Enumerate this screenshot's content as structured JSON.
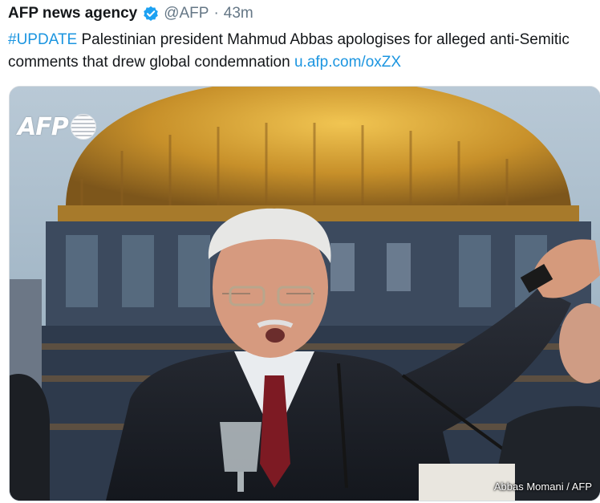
{
  "tweet": {
    "display_name": "AFP news agency",
    "verified_icon": "verified-badge-icon",
    "handle": "@AFP",
    "separator": "·",
    "time": "43m",
    "text": {
      "hashtag": "#UPDATE",
      "body": " Palestinian president Mahmud Abbas apologises for alleged anti-Semitic comments that drew global condemnation ",
      "link": "u.afp.com/oxZX"
    }
  },
  "media": {
    "watermark_logo": "AFP",
    "photo_credit": "Abbas Momani / AFP"
  },
  "colors": {
    "link": "#1b95e0",
    "verified": "#1da1f2",
    "secondary_text": "#657786"
  }
}
